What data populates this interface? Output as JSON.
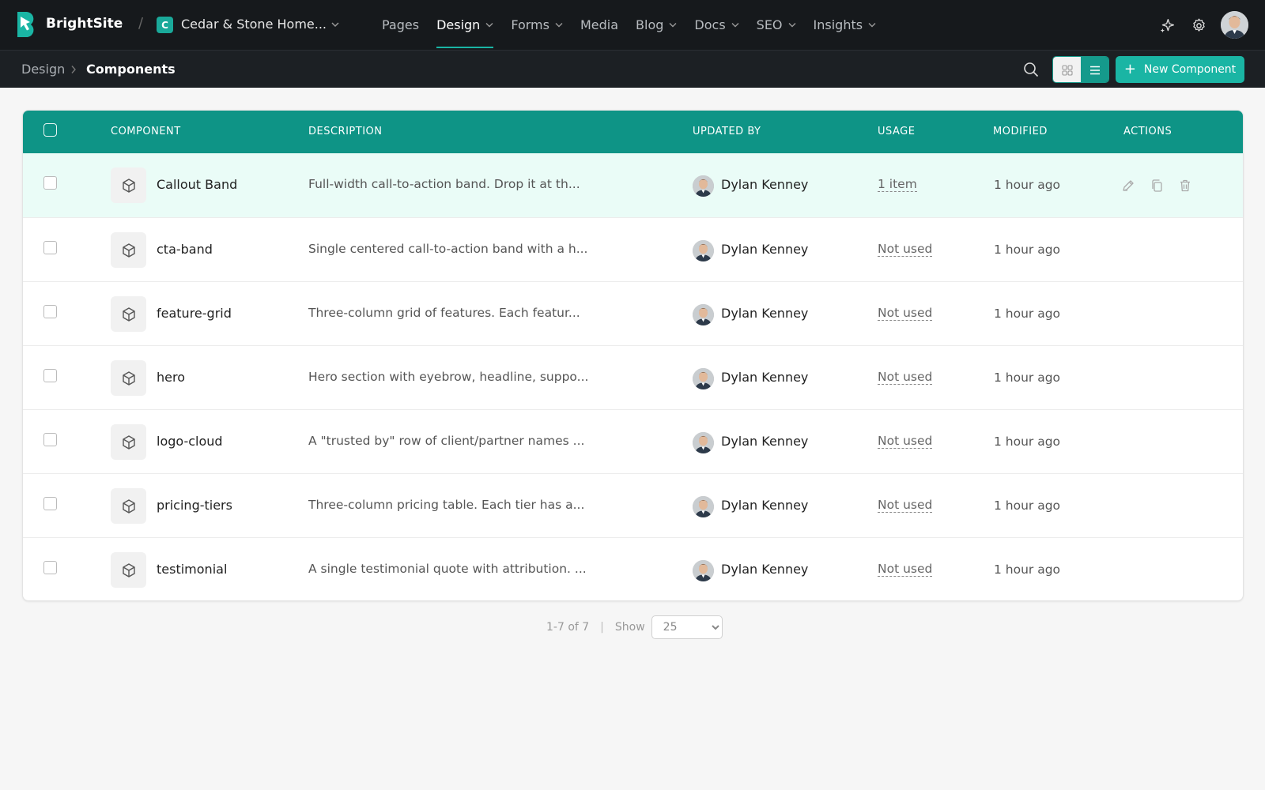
{
  "app": {
    "brand": "BrightSite"
  },
  "site": {
    "badge": "C",
    "name": "Cedar & Stone Home..."
  },
  "nav": [
    {
      "label": "Pages",
      "dropdown": false,
      "active": false
    },
    {
      "label": "Design",
      "dropdown": true,
      "active": true
    },
    {
      "label": "Forms",
      "dropdown": true,
      "active": false
    },
    {
      "label": "Media",
      "dropdown": false,
      "active": false
    },
    {
      "label": "Blog",
      "dropdown": true,
      "active": false
    },
    {
      "label": "Docs",
      "dropdown": true,
      "active": false
    },
    {
      "label": "SEO",
      "dropdown": true,
      "active": false
    },
    {
      "label": "Insights",
      "dropdown": true,
      "active": false
    }
  ],
  "breadcrumb": {
    "parent": "Design",
    "current": "Components"
  },
  "toolbar": {
    "new_label": "New Component"
  },
  "colors": {
    "accent": "#1ab5a4",
    "header": "#0e9486",
    "highlight_row": "#eafcf7",
    "topbar": "#16191c"
  },
  "table": {
    "headers": {
      "component": "COMPONENT",
      "description": "DESCRIPTION",
      "updated_by": "UPDATED BY",
      "usage": "USAGE",
      "modified": "MODIFIED",
      "actions": "ACTIONS"
    },
    "rows": [
      {
        "name": "Callout Band",
        "description": "Full-width call-to-action band. Drop it at th...",
        "user": "Dylan Kenney",
        "usage": "1 item",
        "modified": "1 hour ago",
        "highlighted": true
      },
      {
        "name": "cta-band",
        "description": "Single centered call-to-action band with a h...",
        "user": "Dylan Kenney",
        "usage": "Not used",
        "modified": "1 hour ago",
        "highlighted": false
      },
      {
        "name": "feature-grid",
        "description": "Three-column grid of features. Each featur...",
        "user": "Dylan Kenney",
        "usage": "Not used",
        "modified": "1 hour ago",
        "highlighted": false
      },
      {
        "name": "hero",
        "description": "Hero section with eyebrow, headline, suppo...",
        "user": "Dylan Kenney",
        "usage": "Not used",
        "modified": "1 hour ago",
        "highlighted": false
      },
      {
        "name": "logo-cloud",
        "description": "A \"trusted by\" row of client/partner names ...",
        "user": "Dylan Kenney",
        "usage": "Not used",
        "modified": "1 hour ago",
        "highlighted": false
      },
      {
        "name": "pricing-tiers",
        "description": "Three-column pricing table. Each tier has a...",
        "user": "Dylan Kenney",
        "usage": "Not used",
        "modified": "1 hour ago",
        "highlighted": false
      },
      {
        "name": "testimonial",
        "description": "A single testimonial quote with attribution. ...",
        "user": "Dylan Kenney",
        "usage": "Not used",
        "modified": "1 hour ago",
        "highlighted": false
      }
    ]
  },
  "pagination": {
    "range": "1-7 of 7",
    "separator": "|",
    "show_label": "Show",
    "page_size": "25"
  }
}
